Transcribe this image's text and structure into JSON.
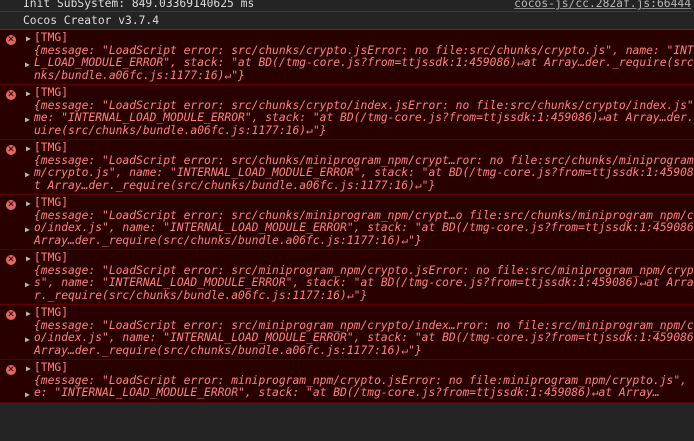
{
  "info_rows": [
    {
      "text": "Init SubSystem: 849.03369140625 ms",
      "link": "cocos-js/cc.282af.js:66444"
    },
    {
      "text": "Cocos Creator v3.7.4",
      "link": ""
    }
  ],
  "errors": [
    {
      "tag": "[TMG]",
      "lines": [
        "{message: \"LoadScript error: src/chunks/crypto.jsError: no file:src/chunks/crypto.js\", name: \"INTERNA",
        "L_LOAD_MODULE_ERROR\", stack: \"at BD(/tmg-core.js?from=ttjssdk:1:459086)↵at Array…der._require(src/chu",
        "nks/bundle.a06fc.js:1177:16)↵\"}"
      ]
    },
    {
      "tag": "[TMG]",
      "lines": [
        "{message: \"LoadScript error: src/chunks/crypto/index.jsError: no file:src/chunks/crypto/index.js\", na",
        "me: \"INTERNAL_LOAD_MODULE_ERROR\", stack: \"at BD(/tmg-core.js?from=ttjssdk:1:459086)↵at Array…der._req",
        "uire(src/chunks/bundle.a06fc.js:1177:16)↵\"}"
      ]
    },
    {
      "tag": "[TMG]",
      "lines": [
        "{message: \"LoadScript error: src/chunks/miniprogram_npm/crypt…ror: no file:src/chunks/miniprogram_npm",
        "m/crypto.js\", name: \"INTERNAL_LOAD_MODULE_ERROR\", stack: \"at BD(/tmg-core.js?from=ttjssdk:1:459086)↵",
        "t Array…der._require(src/chunks/bundle.a06fc.js:1177:16)↵\"}"
      ]
    },
    {
      "tag": "[TMG]",
      "lines": [
        "{message: \"LoadScript error: src/chunks/miniprogram_npm/crypt…o file:src/chunks/miniprogram_npm/crypt",
        "o/index.js\", name: \"INTERNAL_LOAD_MODULE_ERROR\", stack: \"at BD(/tmg-core.js?from=ttjssdk:1:459086)↵a",
        "Array…der._require(src/chunks/bundle.a06fc.js:1177:16)↵\"}"
      ]
    },
    {
      "tag": "[TMG]",
      "lines": [
        "{message: \"LoadScript error: src/miniprogram_npm/crypto.jsError: no file:src/miniprogram_npm/crypto.",
        "s\", name: \"INTERNAL_LOAD_MODULE_ERROR\", stack: \"at BD(/tmg-core.js?from=ttjssdk:1:459086)↵at Array…",
        "r._require(src/chunks/bundle.a06fc.js:1177:16)↵\"}"
      ]
    },
    {
      "tag": "[TMG]",
      "lines": [
        "{message: \"LoadScript error: src/miniprogram_npm/crypto/index…rror: no file:src/miniprogram_npm/crypt",
        "o/index.js\", name: \"INTERNAL_LOAD_MODULE_ERROR\", stack: \"at BD(/tmg-core.js?from=ttjssdk:1:459086)↵a",
        "Array…der._require(src/chunks/bundle.a06fc.js:1177:16)↵\"}"
      ]
    },
    {
      "tag": "[TMG]",
      "lines": [
        "{message: \"LoadScript error: miniprogram_npm/crypto.jsError: no file:miniprogram_npm/crypto.js\", name",
        "e: \"INTERNAL_LOAD_MODULE_ERROR\", stack: \"at BD(/tmg-core.js?from=ttjssdk:1:459086)↵at Array…"
      ]
    }
  ],
  "icons": {
    "error": "error-circle-icon",
    "expand": "expand-triangle-icon"
  }
}
